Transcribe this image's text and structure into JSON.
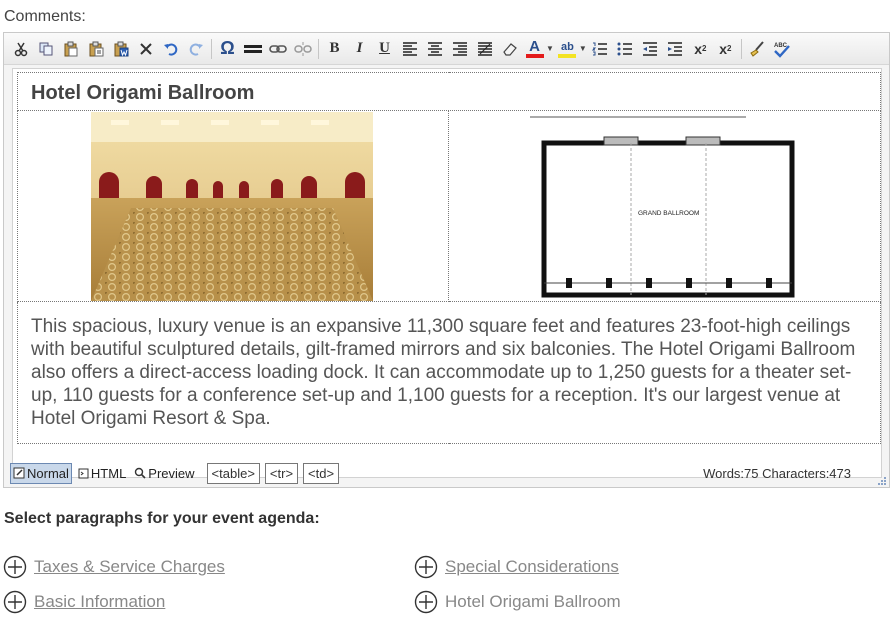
{
  "comments_label": "Comments:",
  "editor": {
    "table": {
      "title": "Hotel Origami Ballroom",
      "plan_label": "GRAND BALLROOM",
      "description": "This spacious, luxury venue is an expansive 11,300 square feet and features 23-foot-high ceilings with beautiful sculptured details, gilt-framed mirrors and six balconies. The Hotel Origami Ballroom also offers a direct-access loading dock. It can accommodate up to 1,250 guests for a theater set-up, 110 guests for a conference set-up and 1,100 guests for a reception. It's our largest venue at Hotel Origami Resort & Spa."
    },
    "modes": {
      "normal": "Normal",
      "html": "HTML",
      "preview": "Preview"
    },
    "tags": [
      "<table>",
      "<tr>",
      "<td>"
    ],
    "stats": "Words:75 Characters:473"
  },
  "agenda": {
    "label": "Select paragraphs for your event agenda:",
    "items": [
      {
        "label": "Taxes & Service Charges",
        "link": true
      },
      {
        "label": "Special Considerations",
        "link": true
      },
      {
        "label": "Basic Information",
        "link": true
      },
      {
        "label": "Hotel Origami Ballroom",
        "link": false
      }
    ]
  }
}
